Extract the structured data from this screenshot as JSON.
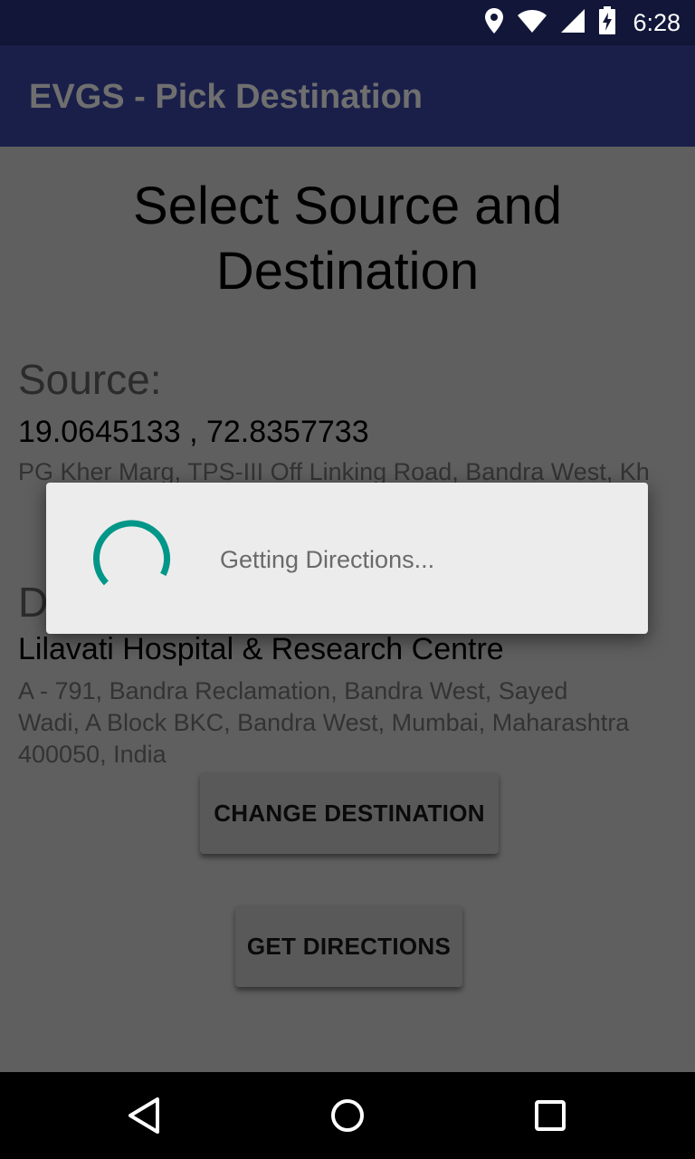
{
  "status_bar": {
    "time": "6:28",
    "icons": [
      "location-icon",
      "wifi-icon",
      "cell-signal-icon",
      "battery-charging-icon"
    ]
  },
  "app_bar": {
    "title": "EVGS - Pick Destination"
  },
  "main": {
    "heading": "Select Source and Destination",
    "source": {
      "label": "Source:",
      "coordinates": "19.0645133 , 72.8357733",
      "address": "PG Kher Marg, TPS-III Off Linking Road, Bandra West, Kh"
    },
    "destination": {
      "label": "D",
      "name": "Lilavati Hospital & Research Centre",
      "address": "A - 791, Bandra Reclamation, Bandra West, Sayed Wadi, A Block BKC, Bandra West, Mumbai, Maharashtra 400050, India"
    },
    "change_destination_label": "CHANGE DESTINATION",
    "get_directions_label": "GET DIRECTIONS"
  },
  "dialog": {
    "message": "Getting Directions...",
    "spinner_color": "#009688"
  },
  "nav_bar": {
    "icons": [
      "back-icon",
      "home-icon",
      "recents-icon"
    ]
  },
  "colors": {
    "status_bar": "#121739",
    "app_bar": "#1a1f4a",
    "scrim_background": "#5f5f5f",
    "dialog_background": "#ececec",
    "accent": "#009688"
  }
}
